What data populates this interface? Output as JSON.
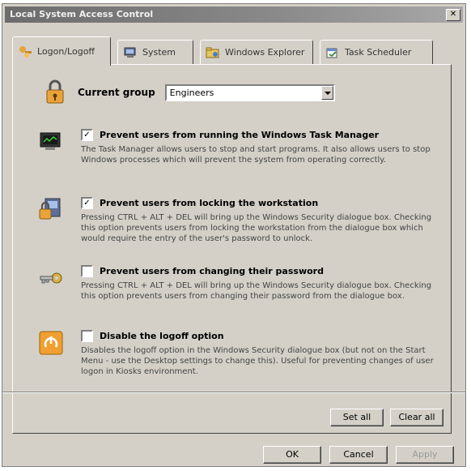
{
  "window": {
    "title": "Local System Access Control",
    "close_glyph": "✕"
  },
  "tabs": [
    {
      "label": "Logon/Logoff",
      "icon": "key-user-icon",
      "active": true
    },
    {
      "label": "System",
      "icon": "computer-icon",
      "active": false
    },
    {
      "label": "Windows Explorer",
      "icon": "folder-explorer-icon",
      "active": false
    },
    {
      "label": "Task Scheduler",
      "icon": "scheduler-icon",
      "active": false
    }
  ],
  "group": {
    "label": "Current group",
    "value": "Engineers",
    "icon": "group-lock-icon"
  },
  "options": [
    {
      "label": "Prevent users from running the Windows Task Manager",
      "checked": true,
      "icon": "task-manager-icon",
      "desc": "The Task Manager allows users to stop and start programs. It also allows users to stop Windows processes which will prevent the system from operating correctly."
    },
    {
      "label": "Prevent users from locking the workstation",
      "checked": true,
      "icon": "lock-workstation-icon",
      "desc": "Pressing CTRL + ALT + DEL will bring up the Windows Security dialogue box. Checking this option prevents users from locking the workstation from the dialogue box which would require the entry of the user's password to unlock."
    },
    {
      "label": "Prevent users from changing their password",
      "checked": false,
      "icon": "key-password-icon",
      "desc": "Pressing CTRL + ALT + DEL will bring up the Windows Security dialogue box. Checking this option prevents users from changing their password from the dialogue box."
    },
    {
      "label": "Disable the logoff option",
      "checked": false,
      "icon": "logoff-icon",
      "desc": "Disables the logoff option in the Windows Security dialogue box (but not on the Start Menu - use the Desktop settings to change this). Useful for preventing changes of user logon in Kiosks environment."
    }
  ],
  "buttons": {
    "set_all": "Set all",
    "clear_all": "Clear all",
    "ok": "OK",
    "cancel": "Cancel",
    "apply": "Apply"
  },
  "colors": {
    "face": "#d4d0c8",
    "title": "#7a7a7a",
    "icon_accent": "#e8a33a"
  }
}
